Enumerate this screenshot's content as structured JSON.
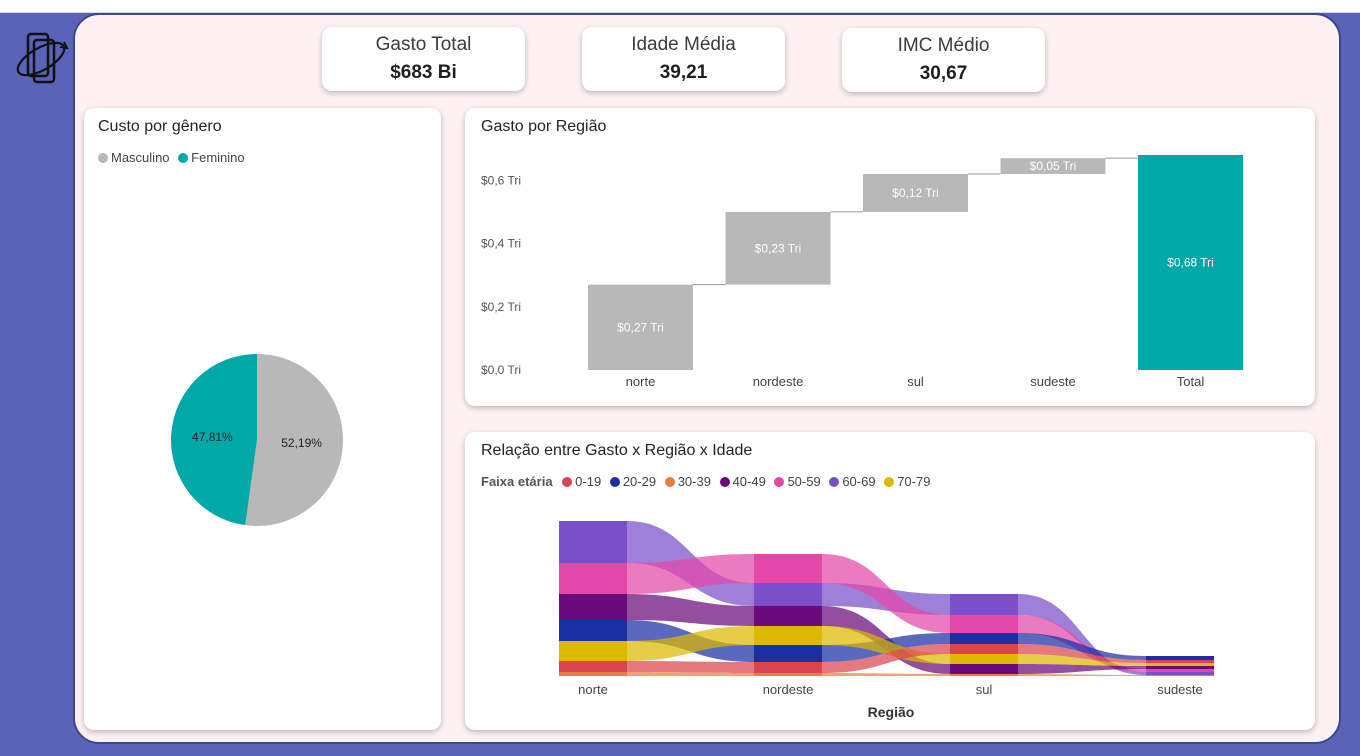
{
  "kpis": [
    {
      "label": "Gasto Total",
      "value": "$683 Bi"
    },
    {
      "label": "Idade Média",
      "value": "39,21"
    },
    {
      "label": "IMC Médio",
      "value": "30,67"
    }
  ],
  "gender_card": {
    "title": "Custo por gênero",
    "legend": [
      {
        "label": "Masculino",
        "color": "#b8b8b8"
      },
      {
        "label": "Feminino",
        "color": "#00a9a8"
      }
    ]
  },
  "region_card": {
    "title": "Gasto por Região"
  },
  "age_card": {
    "title": "Relação entre Gasto x Região x Idade",
    "legend_title": "Faixa etária",
    "legend": [
      {
        "label": "0-19",
        "color": "#d9454f"
      },
      {
        "label": "20-29",
        "color": "#1b2fa3"
      },
      {
        "label": "30-39",
        "color": "#ea7f3c"
      },
      {
        "label": "40-49",
        "color": "#6b0a7a"
      },
      {
        "label": "50-59",
        "color": "#e347a8"
      },
      {
        "label": "60-69",
        "color": "#7a4fc9"
      },
      {
        "label": "70-79",
        "color": "#dcb800"
      }
    ],
    "x_title": "Região"
  },
  "chart_data": [
    {
      "type": "pie",
      "title": "Custo por gênero",
      "series": [
        {
          "name": "Masculino",
          "value": 52.19,
          "label": "52,19%",
          "color": "#b8b8b8"
        },
        {
          "name": "Feminino",
          "value": 47.81,
          "label": "47,81%",
          "color": "#00a9a8"
        }
      ]
    },
    {
      "type": "bar",
      "subtype": "waterfall",
      "title": "Gasto por Região",
      "categories": [
        "norte",
        "nordeste",
        "sul",
        "sudeste",
        "Total"
      ],
      "values": [
        0.27,
        0.23,
        0.12,
        0.05,
        0.68
      ],
      "value_labels": [
        "$0,27 Tri",
        "$0,23 Tri",
        "$0,12 Tri",
        "$0,05 Tri",
        "$0,68 Tri"
      ],
      "total_index": 4,
      "y_ticks": [
        "$0,0 Tri",
        "$0,2 Tri",
        "$0,4 Tri",
        "$0,6 Tri"
      ],
      "ylim": [
        0,
        0.68
      ],
      "colors": {
        "step": "#b8b8b8",
        "total": "#00a9a8"
      }
    },
    {
      "type": "area",
      "subtype": "ribbon",
      "title": "Relação entre Gasto x Região x Idade",
      "xlabel": "Região",
      "categories": [
        "norte",
        "nordeste",
        "sul",
        "sudeste"
      ],
      "series": [
        {
          "name": "60-69",
          "values": [
            42,
            23,
            21,
            3
          ]
        },
        {
          "name": "50-59",
          "values": [
            31,
            29,
            18,
            3
          ]
        },
        {
          "name": "40-49",
          "values": [
            26,
            20,
            10,
            3
          ]
        },
        {
          "name": "20-29",
          "values": [
            21,
            17,
            11,
            4
          ]
        },
        {
          "name": "70-79",
          "values": [
            20,
            19,
            10,
            3
          ]
        },
        {
          "name": "0-19",
          "values": [
            11,
            11,
            10,
            3
          ]
        },
        {
          "name": "30-39",
          "values": [
            4,
            3,
            2,
            1
          ]
        }
      ]
    }
  ]
}
